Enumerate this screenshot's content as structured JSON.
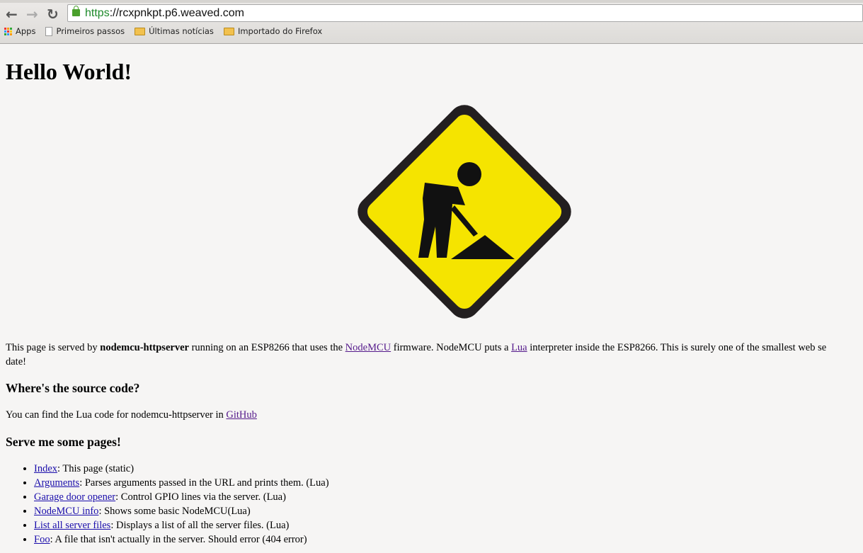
{
  "browser": {
    "url_scheme": "https",
    "url_rest": "://rcxpnkpt.p6.weaved.com",
    "bookmarks": [
      {
        "label": "Apps",
        "icon": "apps-grid-icon"
      },
      {
        "label": "Primeiros passos",
        "icon": "page-icon"
      },
      {
        "label": "Últimas notícias",
        "icon": "folder-icon"
      },
      {
        "label": "Importado do Firefox",
        "icon": "folder-icon"
      }
    ]
  },
  "page": {
    "title": "Hello World!",
    "intro": {
      "t1": "This page is served by ",
      "bold": "nodemcu-httpserver",
      "t2": " running on an ESP8266 that uses the ",
      "link1": "NodeMCU",
      "t3": " firmware. NodeMCU puts a ",
      "link2": "Lua",
      "t4": " interpreter inside the ESP8266. This is surely one of the smallest web se",
      "line2": "date!"
    },
    "source_heading": "Where's the source code?",
    "source_text": "You can find the Lua code for nodemcu-httpserver in ",
    "source_link": "GitHub",
    "serve_heading": "Serve me some pages!",
    "items": [
      {
        "link": "Index",
        "desc": ": This page (static)"
      },
      {
        "link": "Arguments",
        "desc": ": Parses arguments passed in the URL and prints them. (Lua)"
      },
      {
        "link": "Garage door opener",
        "desc": ": Control GPIO lines via the server. (Lua)"
      },
      {
        "link": "NodeMCU info",
        "desc": ": Shows some basic NodeMCU(Lua)"
      },
      {
        "link": "List all server files",
        "desc": ": Displays a list of all the server files. (Lua)"
      },
      {
        "link": "Foo",
        "desc": ": A file that isn't actually in the server. Should error (404 error)"
      }
    ]
  },
  "colors": {
    "sign_yellow": "#f5e400",
    "sign_border": "#231f20"
  }
}
